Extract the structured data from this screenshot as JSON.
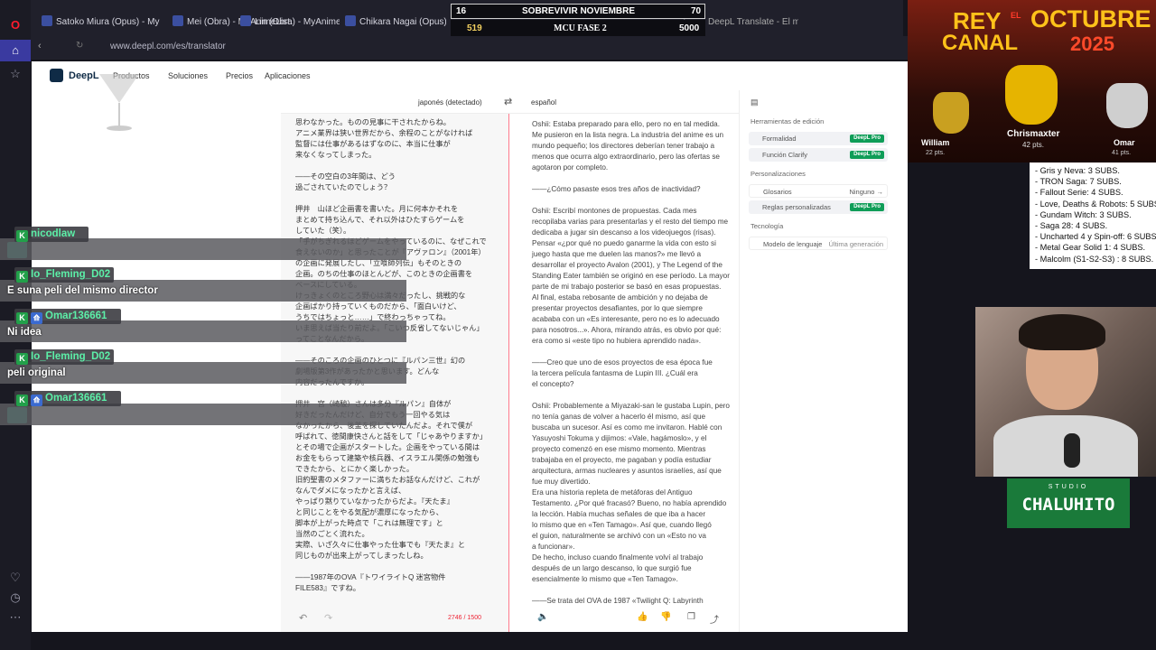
{
  "browser": {
    "tabs": [
      {
        "label": "Satoko Miura (Opus) - My"
      },
      {
        "label": "Mei (Obra) - MyAnimeList."
      },
      {
        "label": "Lin (Obra) - MyAnimeList."
      },
      {
        "label": "Chikara Nagai (Opus) - M"
      },
      {
        "label": "DeepL Translate - El mejo"
      }
    ],
    "url": "www.deepl.com/es/translator"
  },
  "deepl": {
    "logo": "DeepL",
    "nav": [
      "Productos",
      "Soluciones",
      "Precios",
      "Aplicaciones"
    ],
    "source_lang": "japonés (detectado)",
    "target_lang": "español",
    "char_count": "2746 / 1500",
    "source_text": "思わなかった。ものの見事に干されたからね。\nアニメ業界は狭い世界だから、余程のことがなければ\n監督には仕事があるはずなのに、本当に仕事が\n来なくなってしまった。\n\n――その空白の3年間は、どう\n過ごされていたのでしょう？\n\n押井　山ほど企画書を書いた。月に何本かそれを\nまとめて持ち込んで、それ以外はひたすらゲームを\nしていた（笑）。\n「手がちぎれるほどゲームをやっているのに、なぜこれで\n食えないのか」と思ったことが『アヴァロン』（2001年）\nの企画に発展したし、「立喰師列伝」もそのときの\n企画。のちの仕事のほとんどが、このときの企画書を\nベースにしている。\nけっきょくのところ野心は満々だったし、挑戦的な\n企画ばかり持っていくものだから、「面白いけど、\nうちではちょっと……」で終わっちゃってね。\nいま思えば当たり前だよ。「こいつ反省してないじゃん」\nってことなんだから。\n\n――そのころの企画のひとつに『ルパン三世』幻の\n劇場版第3作があったかと思います。どんな\n内容だったんですか。\n\n押井　宮（崎駿）さんは多分『ルパン』自体が\n好きだったんだけど、自分でもう一回やる気は\nなかったから、後釜を探していたんだよ。それで僕が\n呼ばれて、徳間康快さんと話をして「じゃあやりますか」\nとその場で企画がスタートした。企画をやっている間は\nお金をもらって建築や核兵器、イスラエル関係の勉強も\nできたから、とにかく楽しかった。\n旧約聖書のメタファーに満ちたお話なんだけど、これが\nなんでダメになったかと言えば、\nやっぱり黙りていなかったからだよ。『天たま』\nと同じことをやる気配が濃厚になったから、\n脚本が上がった時点で「これは無理です」と\n当然のごとく流れた。\n実際、いざ久々に仕事やった仕事でも『天たま』と\n同じものが出来上がってしまったしね。\n\n――1987年のOVA『トワイライトQ 迷宮物件\nFILE583』ですね。",
    "target_text": "Oshii: Estaba preparado para ello, pero no en tal medida.\nMe pusieron en la lista negra. La industria del anime es un\nmundo pequeño; los directores deberían tener trabajo a\nmenos que ocurra algo extraordinario, pero las ofertas se\nagotaron por completo.\n\n――¿Cómo pasaste esos tres años de inactividad?\n\nOshii: Escribí montones de propuestas. Cada mes\nrecopilaba varias para presentarlas y el resto del tiempo me\ndedicaba a jugar sin descanso a los videojuegos (risas).\nPensar «¿por qué no puedo ganarme la vida con esto si\njuego hasta que me duelen las manos?» me llevó a\ndesarrollar el proyecto Avalon (2001), y The Legend of the\nStanding Eater también se originó en ese período. La mayor\nparte de mi trabajo posterior se basó en esas propuestas.\nAl final, estaba rebosante de ambición y no dejaba de\npresentar proyectos desafiantes, por lo que siempre\nacababa con un «Es interesante, pero no es lo adecuado\npara nosotros...». Ahora, mirando atrás, es obvio por qué:\nera como si «este tipo no hubiera aprendido nada».\n\n――Creo que uno de esos proyectos de esa época fue\nla tercera película fantasma de Lupin III. ¿Cuál era\nel concepto?\n\nOshii: Probablemente a Miyazaki-san le gustaba Lupin, pero\nno tenía ganas de volver a hacerlo él mismo, así que\nbuscaba un sucesor. Así es como me invitaron. Hablé con\nYasuyoshi Tokuma y dijimos: «Vale, hagámoslo», y el\nproyecto comenzó en ese mismo momento. Mientras\ntrabajaba en el proyecto, me pagaban y podía estudiar\narquitectura, armas nucleares y asuntos israelíes, así que\nfue muy divertido.\nEra una historia repleta de metáforas del Antiguo\nTestamento. ¿Por qué fracasó? Bueno, no había aprendido\nla lección. Había muchas señales de que iba a hacer\nlo mismo que en «Ten Tamago». Así que, cuando llegó\nel guion, naturalmente se archivó con un «Esto no va\na funcionar».\nDe hecho, incluso cuando finalmente volví al trabajo\ndespués de un largo descanso, lo que surgió fue\nesencialmente lo mismo que «Ten Tamago».\n\n――Se trata del OVA de 1987 «Twilight Q: Labyrinth",
    "side": {
      "edit_tools": "Herramientas de edición",
      "formality": "Formalidad",
      "clarify": "Función Clarify",
      "pro": "DeepL Pro",
      "personalization": "Personalizaciones",
      "glossaries": "Glosarios",
      "glossaries_value": "Ninguno →",
      "custom_rules": "Reglas personalizadas",
      "technology": "Tecnología",
      "language_model": "Modelo de lenguaje",
      "language_model_value": "Última generación"
    }
  },
  "overlay": {
    "banner": {
      "left": "16",
      "title": "SOBREVIVIR NOVIEMBRE",
      "right": "70"
    },
    "subbanner": {
      "left": "519",
      "title": "MCU FASE 2",
      "right": "5000"
    },
    "rey": {
      "title1": "REY",
      "title_el": "EL",
      "title2": "CANAL",
      "month": "OCTUBRE",
      "year": "2025",
      "p1_name": "William",
      "p1_pts": "22 pts.",
      "p2_name": "Chrismaxter",
      "p2_pts": "42 pts.",
      "p3_name": "Omar",
      "p3_pts": "41 pts."
    },
    "subs": [
      "- Gris y Neva: 3 SUBS.",
      "- TRON Saga: 7 SUBS.",
      "- Fallout Serie: 4 SUBS.",
      "- Love, Deaths & Robots: 5 SUBS.",
      "- Gundam Witch: 3 SUBS.",
      "- Saga 28: 4 SUBS.",
      "- Uncharted 4 y Spin-off: 6 SUBS.",
      "- Metal Gear Solid 1: 4 SUBS.",
      "- Malcolm (S1-S2-S3) : 8 SUBS."
    ],
    "studio": {
      "small": "STUDIO",
      "name": "CHALUHITO"
    }
  },
  "chat": [
    {
      "user": "nicodlaw",
      "msg": ""
    },
    {
      "user": "Io_Fleming_D02",
      "msg": "E suna peli del mismo director"
    },
    {
      "user": "Omar136661",
      "msg": "Ni idea"
    },
    {
      "user": "Io_Fleming_D02",
      "msg": "peli original"
    },
    {
      "user": "Omar136661",
      "msg": ""
    }
  ],
  "colors": {
    "accent": "#0f2b46",
    "pro": "#0f9d58",
    "chat_user": "#5cf0a8"
  }
}
